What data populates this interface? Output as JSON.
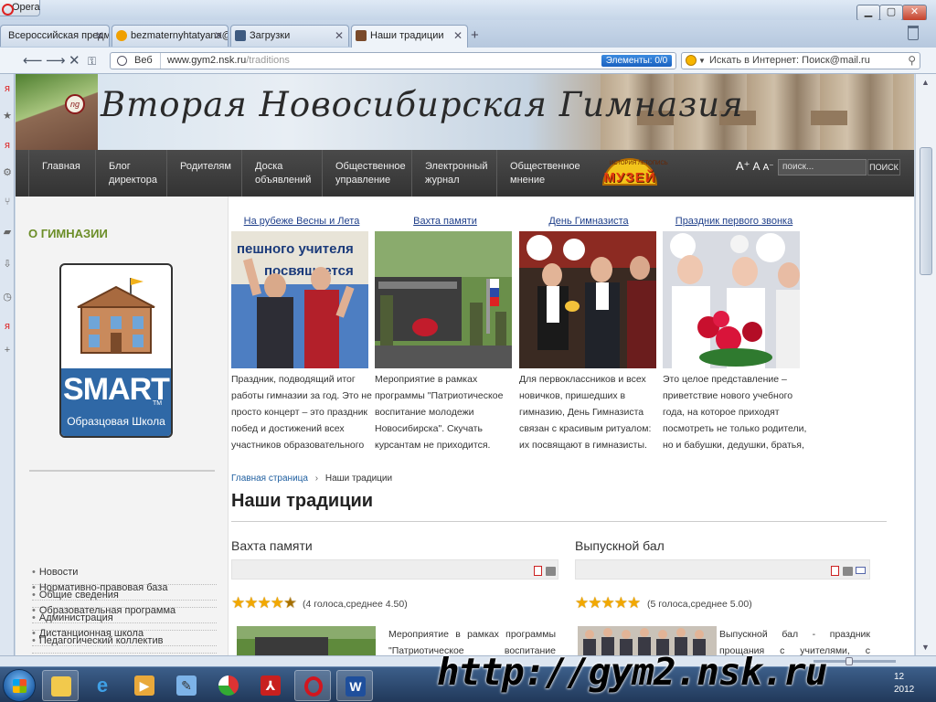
{
  "browser": {
    "menu_label": "Opera",
    "tabs": [
      {
        "label": "Всероссийская предм...",
        "active": false
      },
      {
        "label": "bezmaternyhtatyana@...",
        "active": false
      },
      {
        "label": "Загрузки",
        "active": false
      },
      {
        "label": "Наши традиции",
        "active": true
      }
    ],
    "address": {
      "scope_label": "Веб",
      "url_host": "www.gym2.nsk.ru",
      "url_path": "/traditions"
    },
    "elements_badge": "Элементы:  0/0",
    "search_placeholder": "Искать в Интернет: Поиск@mail.ru"
  },
  "site": {
    "title": "Вторая Новосибирская Гимназия",
    "menu": [
      {
        "line1": "Главная",
        "line2": ""
      },
      {
        "line1": "Блог",
        "line2": "директора"
      },
      {
        "line1": "Родителям",
        "line2": ""
      },
      {
        "line1": "Доска",
        "line2": "объявлений"
      },
      {
        "line1": "Общественное",
        "line2": "управление"
      },
      {
        "line1": "Электронный",
        "line2": "журнал"
      },
      {
        "line1": "Общественное",
        "line2": "мнение"
      }
    ],
    "museum_logo": {
      "arc_text": "ИСТОРИЯ ЛЕТОПИСЬ",
      "word": "МУЗЕЙ"
    },
    "font_controls": {
      "a1": "A⁺",
      "a2": "A",
      "a3": "A⁻"
    },
    "search_placeholder": "поиск...",
    "search_button": "ПОИСК"
  },
  "sidebar": {
    "heading": "О ГИМНАЗИИ",
    "smart_logo": {
      "word": "SMART",
      "tm": "TM",
      "subtitle": "Образцовая Школа"
    },
    "links": [
      "Новости",
      "Общие сведения",
      "Администрация",
      "Педагогический коллектив",
      "Нормативно-правовая база",
      "Образовательная программа",
      "Дистанционная школа"
    ]
  },
  "features": [
    {
      "title": "На рубеже Весны и Лета",
      "text": "Праздник, подводящий итог работы гимназии за год. Это не просто концерт – это праздник побед и достижений всех участников образовательного процесса. ...",
      "image_banner": "пешного учителя посвящается"
    },
    {
      "title": "Вахта памяти",
      "text": "Мероприятие в рамках программы \"Патриотическое воспитание молодежи Новосибирска\". Скучать курсантам не приходится. Стрельба и дартс, сборка-разборка автомата"
    },
    {
      "title": "День Гимназиста",
      "text": "Для первоклассников и всех новичков, пришедших в гимназию, День Гимназиста связан с красивым ритуалом: их посвящают в гимназисты. Они передают друг"
    },
    {
      "title": "Праздник первого звонка",
      "text": "Это целое представление – приветствие нового учебного года, на которое приходят посмотреть не только родители, но и бабушки, дедушки, братья, сестры, другие"
    }
  ],
  "breadcrumb": {
    "home": "Главная страница",
    "separator": "›",
    "current": "Наши традиции"
  },
  "page_heading": "Наши традиции",
  "articles": [
    {
      "title": "Вахта памяти",
      "rating": 4.5,
      "rating_text": "(4 голоса,среднее 4.50)",
      "snippet": "Мероприятие в рамках программы \"Патриотическое воспитание молодежи"
    },
    {
      "title": "Выпускной бал",
      "rating": 5,
      "rating_text": "(5 голоса,среднее 5.00)",
      "snippet": "Выпускной бал - праздник прощания с учителями, с гимназией, с детством"
    }
  ],
  "taskbar": {
    "clock_time": "12",
    "clock_date": "2012"
  },
  "overlay_url": "http://gym2.nsk.ru"
}
